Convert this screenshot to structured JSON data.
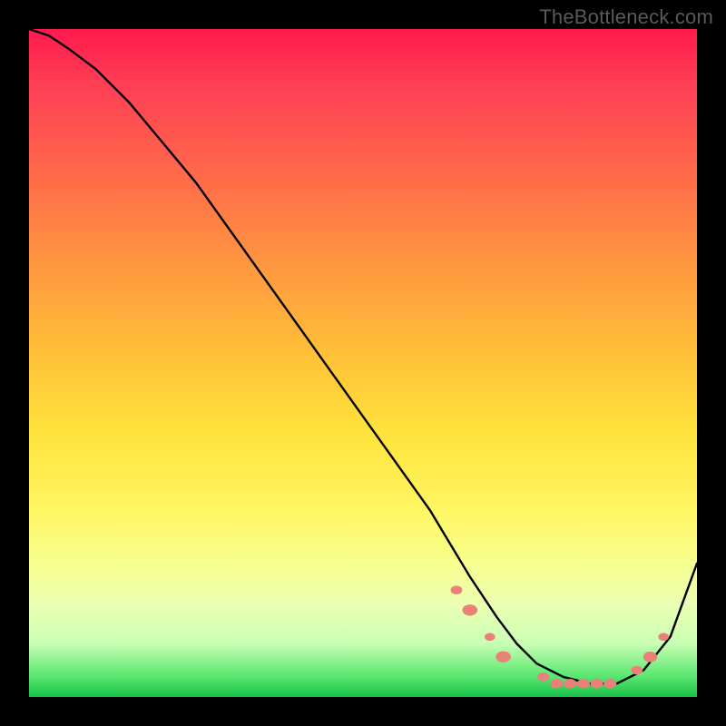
{
  "watermark": "TheBottleneck.com",
  "chart_data": {
    "type": "line",
    "title": "",
    "xlabel": "",
    "ylabel": "",
    "xlim": [
      0,
      100
    ],
    "ylim": [
      0,
      100
    ],
    "grid": false,
    "legend": false,
    "series": [
      {
        "name": "bottleneck-curve",
        "color": "#000000",
        "x": [
          0,
          3,
          6,
          10,
          15,
          20,
          25,
          30,
          35,
          40,
          45,
          50,
          55,
          60,
          63,
          66,
          70,
          73,
          76,
          80,
          84,
          88,
          92,
          96,
          100
        ],
        "y": [
          100,
          99,
          97,
          94,
          89,
          83,
          77,
          70,
          63,
          56,
          49,
          42,
          35,
          28,
          23,
          18,
          12,
          8,
          5,
          3,
          2,
          2,
          4,
          9,
          20
        ]
      }
    ],
    "markers": {
      "name": "highlight-dots",
      "color": "#e98178",
      "points": [
        {
          "x": 64,
          "y": 16,
          "r": 2.0
        },
        {
          "x": 66,
          "y": 13,
          "r": 2.6
        },
        {
          "x": 69,
          "y": 9,
          "r": 1.8
        },
        {
          "x": 71,
          "y": 6,
          "r": 2.6
        },
        {
          "x": 77,
          "y": 3,
          "r": 2.0
        },
        {
          "x": 79,
          "y": 2,
          "r": 2.2
        },
        {
          "x": 81,
          "y": 2,
          "r": 2.2
        },
        {
          "x": 83,
          "y": 2,
          "r": 2.2
        },
        {
          "x": 85,
          "y": 2,
          "r": 2.2
        },
        {
          "x": 87,
          "y": 2,
          "r": 2.2
        },
        {
          "x": 91,
          "y": 4,
          "r": 2.0
        },
        {
          "x": 93,
          "y": 6,
          "r": 2.4
        },
        {
          "x": 95,
          "y": 9,
          "r": 1.8
        }
      ]
    }
  }
}
